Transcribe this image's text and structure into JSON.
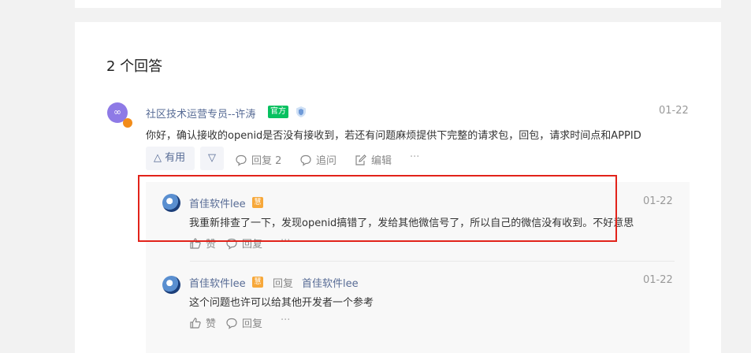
{
  "answers_header": {
    "count_label": "2 个回答"
  },
  "answer": {
    "author": "社区技术运营专员--许涛",
    "official_badge": "官方",
    "date": "01-22",
    "content": "你好，确认接收的openid是否没有接收到，若还有问题麻烦提供下完整的请求包，回包，请求时间点和APPID",
    "actions": {
      "useful_label": "有用",
      "reply_label": "回复 2",
      "followup_label": "追问",
      "edit_label": "编辑",
      "more_label": "···"
    }
  },
  "replies": [
    {
      "author": "首佳软件lee",
      "level_badge": "慧",
      "date": "01-22",
      "content": "我重新排查了一下，发现openid搞错了，发给其他微信号了，所以自己的微信没有收到。不好意思",
      "like_label": "赞",
      "reply_label": "回复",
      "more_label": "···"
    },
    {
      "author": "首佳软件lee",
      "level_badge": "慧",
      "reply_word": "回复",
      "reply_target": "首佳软件lee",
      "date": "01-22",
      "content": "这个问题也许可以给其他开发者一个参考",
      "like_label": "赞",
      "reply_label": "回复",
      "more_label": "···"
    }
  ],
  "colors": {
    "link": "#576b95",
    "official": "#07c160",
    "highlight": "#e2231a",
    "level": "#f7a83a"
  }
}
